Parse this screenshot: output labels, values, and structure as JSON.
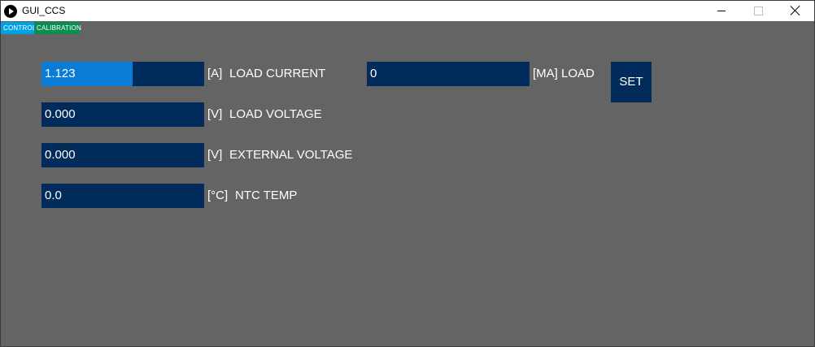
{
  "window": {
    "title": "GUI_CCS",
    "icon": "play-circle-icon",
    "controls": [
      "minimize-icon",
      "maximize-icon",
      "close-icon"
    ]
  },
  "tabs": {
    "control": "CONTROL",
    "calibration": "CALIBRATION"
  },
  "colors": {
    "background": "#646464",
    "field": "#012b5a",
    "field_fill": "#0b7cd6",
    "tab_control": "#00a2e6",
    "tab_calibration": "#0c8d4f"
  },
  "fields": {
    "load_current": {
      "value": "1.123",
      "unit": "[A]",
      "label": "LOAD CURRENT",
      "fill_fraction": 0.56
    },
    "load_voltage": {
      "value": "0.000",
      "unit": "[V]",
      "label": "LOAD VOLTAGE"
    },
    "external_voltage": {
      "value": "0.000",
      "unit": "[V]",
      "label": "EXTERNAL VOLTAGE"
    },
    "ntc_temp": {
      "value": "0.0",
      "unit": "[°C]",
      "label": "NTC TEMP"
    },
    "set_load": {
      "value": "0",
      "unit_label": "[MA] LOAD"
    }
  },
  "buttons": {
    "set": "SET"
  }
}
